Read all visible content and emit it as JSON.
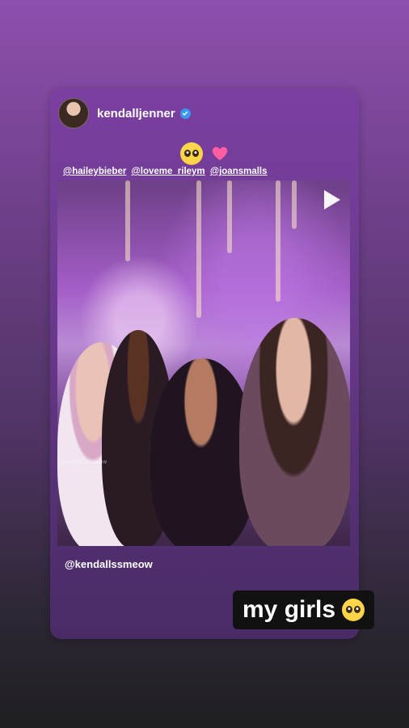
{
  "story": {
    "post": {
      "username": "kendalljenner",
      "emoji_icons": [
        "pleading-face-icon",
        "pink-heart-icon"
      ],
      "mentions": [
        "@haileybieber",
        "@loveme_rileym",
        "@joansmalls"
      ],
      "media_watermark": "@KENDALLSSMEOW",
      "caption_mention": "@kendallssmeow"
    },
    "sticker": {
      "text": "my girls",
      "emoji_icon": "pleading-face-icon"
    }
  }
}
